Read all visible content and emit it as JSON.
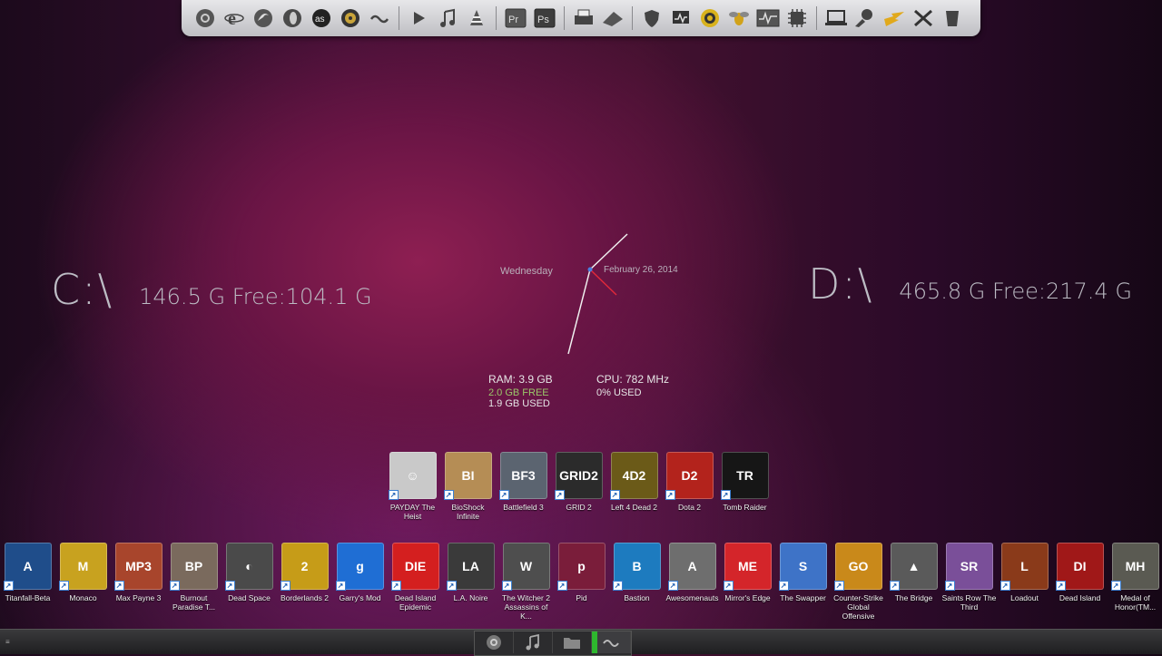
{
  "top_dock": {
    "icons": [
      "chrome-icon",
      "ie-icon",
      "firefox-icon",
      "opera-icon",
      "lastfm-icon",
      "cd-icon",
      "link-icon",
      "play-icon",
      "music-icon",
      "vlc-icon",
      "premiere-icon",
      "photoshop-icon",
      "printer-icon",
      "scanner-icon",
      "shield-icon",
      "monitor-icon",
      "norton-icon",
      "bee-icon",
      "graph-icon",
      "chip-icon",
      "laptop-icon",
      "user-icon",
      "lightning-icon",
      "tools-icon",
      "trash-icon"
    ],
    "premiere_label": "Pr",
    "photoshop_label": "Ps",
    "lastfm_label": "as"
  },
  "drives": {
    "c": {
      "letter": "C:\\",
      "info": "146.5 G  Free:104.1 G"
    },
    "d": {
      "letter": "D:\\",
      "info": "465.8 G  Free:217.4 G"
    }
  },
  "clock": {
    "day": "Wednesday",
    "date": "February 26, 2014"
  },
  "ram": {
    "total": "RAM: 3.9 GB",
    "free": "2.0 GB FREE",
    "used": "1.9 GB USED"
  },
  "cpu": {
    "speed": "CPU: 782 MHz",
    "usage": "0% USED"
  },
  "top_games": [
    {
      "label": "PAYDAY The Heist",
      "tile": "☺",
      "color": "#c9c9c9"
    },
    {
      "label": "BioShock Infinite",
      "tile": "BI",
      "color": "#b58d55"
    },
    {
      "label": "Battlefield 3",
      "tile": "BF3",
      "color": "#5b6470"
    },
    {
      "label": "GRID 2",
      "tile": "GRID2",
      "color": "#2b2b2b"
    },
    {
      "label": "Left 4 Dead 2",
      "tile": "4D2",
      "color": "#6b5a18"
    },
    {
      "label": "Dota 2",
      "tile": "D2",
      "color": "#b3231c"
    },
    {
      "label": "Tomb Raider",
      "tile": "TR",
      "color": "#161616"
    }
  ],
  "bottom_games": [
    {
      "label": "Titanfall-Beta",
      "tile": "A",
      "color": "#1f4d8a"
    },
    {
      "label": "Monaco",
      "tile": "M",
      "color": "#c8a21f"
    },
    {
      "label": "Max Payne 3",
      "tile": "MP3",
      "color": "#a8452c"
    },
    {
      "label": "Burnout Paradise T...",
      "tile": "BP",
      "color": "#7a6a5d"
    },
    {
      "label": "Dead Space",
      "tile": "◐",
      "color": "#4a4a4a"
    },
    {
      "label": "Borderlands 2",
      "tile": "2",
      "color": "#c69c18"
    },
    {
      "label": "Garry's Mod",
      "tile": "g",
      "color": "#1f6ed4"
    },
    {
      "label": "Dead Island Epidemic",
      "tile": "DIE",
      "color": "#d41f1f"
    },
    {
      "label": "L.A. Noire",
      "tile": "LA",
      "color": "#3a3a3a"
    },
    {
      "label": "The Witcher 2 Assassins of K...",
      "tile": "W",
      "color": "#4e4e4e"
    },
    {
      "label": "Pid",
      "tile": "p",
      "color": "#7a1d3a"
    },
    {
      "label": "Bastion",
      "tile": "B",
      "color": "#1d7bbf"
    },
    {
      "label": "Awesomenauts",
      "tile": "A",
      "color": "#6e6e6e"
    },
    {
      "label": "Mirror's Edge",
      "tile": "ME",
      "color": "#d4252a"
    },
    {
      "label": "The Swapper",
      "tile": "S",
      "color": "#3e73c7"
    },
    {
      "label": "Counter-Strike Global Offensive",
      "tile": "GO",
      "color": "#c9891a"
    },
    {
      "label": "The Bridge",
      "tile": "▲",
      "color": "#5a5a5a"
    },
    {
      "label": "Saints Row The Third",
      "tile": "SR",
      "color": "#7a4f99"
    },
    {
      "label": "Loadout",
      "tile": "L",
      "color": "#8a3a1a"
    },
    {
      "label": "Dead Island",
      "tile": "DI",
      "color": "#a01818"
    },
    {
      "label": "Medal of Honor(TM...",
      "tile": "MH",
      "color": "#5a5a52"
    }
  ],
  "taskbar": {
    "start_label": "≡",
    "buttons": [
      "chrome-icon",
      "music-icon",
      "folder-icon",
      "link-icon"
    ]
  }
}
